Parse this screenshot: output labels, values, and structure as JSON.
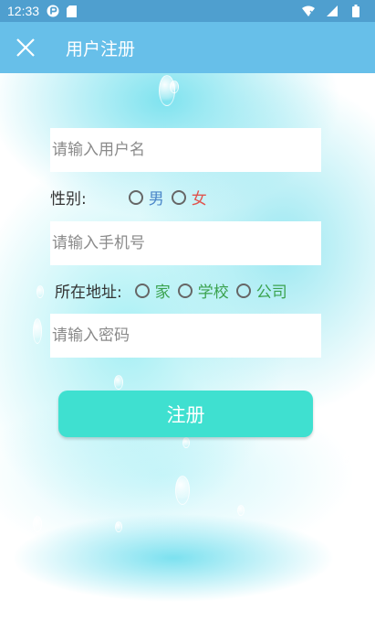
{
  "status_bar": {
    "time": "12:33",
    "icons": [
      "notification-icon",
      "sd-card-icon",
      "wifi-icon",
      "signal-icon",
      "battery-icon"
    ]
  },
  "app_bar": {
    "title": "用户注册",
    "close_icon": "close-icon",
    "background_color": "#67bfe9"
  },
  "form": {
    "username": {
      "placeholder": "请输入用户名",
      "value": ""
    },
    "gender": {
      "label": "性别:",
      "options": [
        {
          "label": "男",
          "color": "#4a86c8",
          "selected": false
        },
        {
          "label": "女",
          "color": "#e0554f",
          "selected": false
        }
      ]
    },
    "phone": {
      "placeholder": "请输入手机号",
      "value": ""
    },
    "address": {
      "label": "所在地址:",
      "options": [
        {
          "label": "家",
          "color": "#3aa24e",
          "selected": false
        },
        {
          "label": "学校",
          "color": "#3aa24e",
          "selected": false
        },
        {
          "label": "公司",
          "color": "#3aa24e",
          "selected": false
        }
      ]
    },
    "password": {
      "placeholder": "请输入密码",
      "value": ""
    },
    "submit_label": "注册",
    "submit_color": "#3fe0d0"
  }
}
